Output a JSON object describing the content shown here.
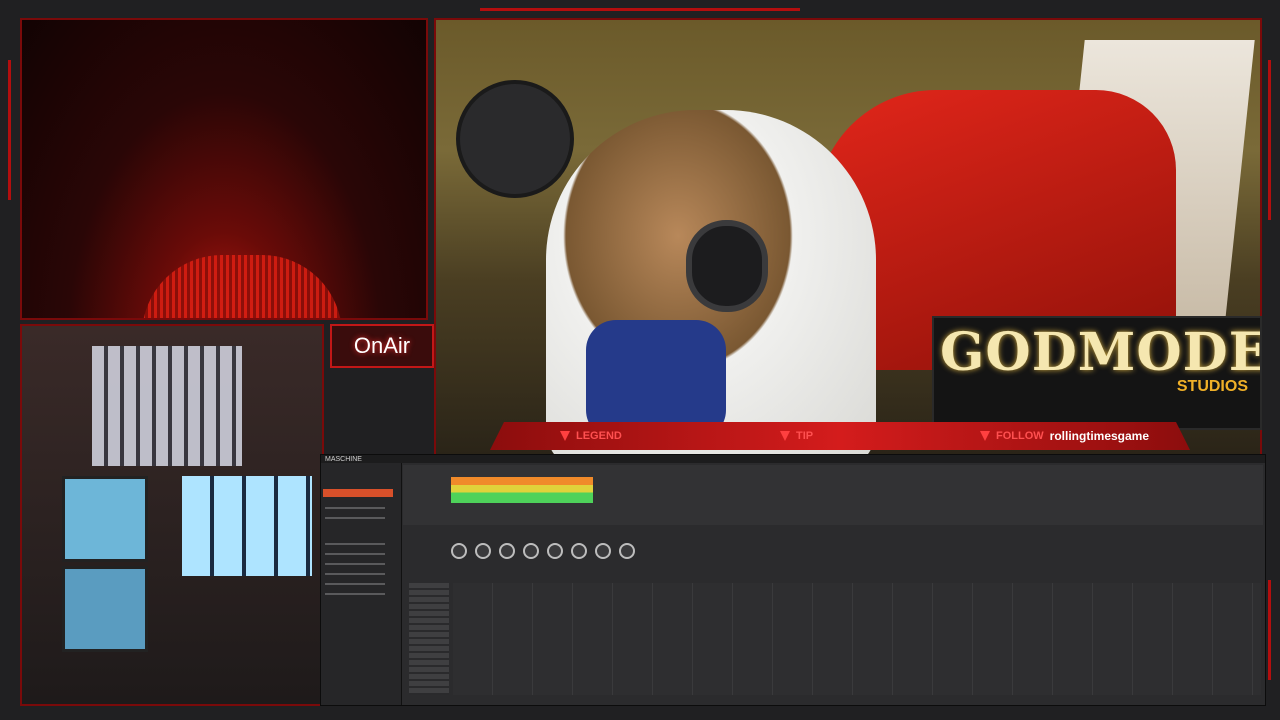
{
  "overlay": {
    "on_air_label": "OnAir",
    "logo_title": "GODMODE",
    "logo_subtitle": "STUDIOS"
  },
  "banner": {
    "legend_label": "LEGEND",
    "tip_label": "TIP",
    "follow_label": "FOLLOW",
    "follow_name": "rollingtimesgame"
  },
  "daw": {
    "app_title": "MASCHINE"
  },
  "colors": {
    "frame_red": "#b30e0e",
    "accent_red": "#d41c1c",
    "logo_gold": "#f5e7b0"
  }
}
